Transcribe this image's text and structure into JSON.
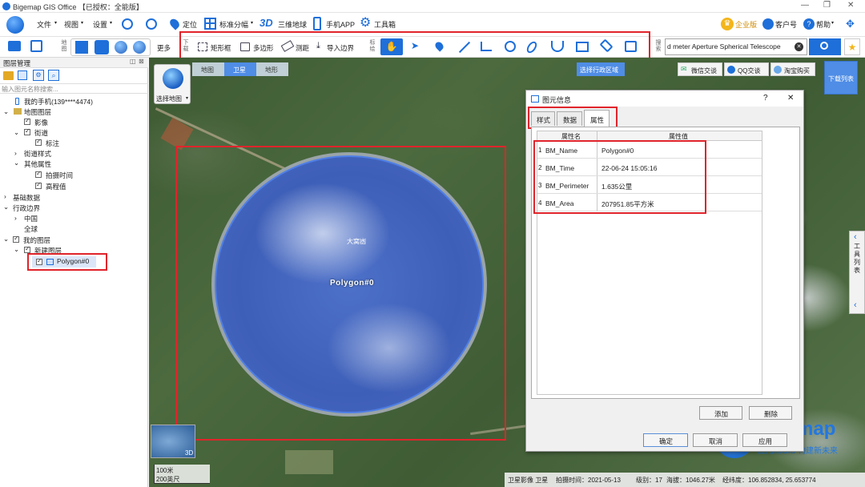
{
  "titlebar": {
    "title": "Bigemap GIS Office 【已授权：全能版】"
  },
  "menu": {
    "file": "文件",
    "view": "视图",
    "settings": "设置",
    "locate": "定位",
    "standard_tiles": "标准分幅",
    "three_d": "3D",
    "three_d_earth": "三维地球",
    "mobile_app": "手机APP",
    "toolbox": "工具箱",
    "enterprise": "企业版",
    "customer": "客户号",
    "help": "帮助"
  },
  "toolbar": {
    "map_label": "地图",
    "more": "更多",
    "download_label": "下载",
    "rect_frame": "矩形框",
    "polygon": "多边形",
    "measure": "测距",
    "import_boundary": "导入边界",
    "mark_label": "标绘",
    "search_label": "搜索",
    "search_value": "d meter Aperture Spherical Telescope"
  },
  "leftpanel": {
    "title": "图层管理",
    "search_placeholder": "输入图元名称搜索...",
    "tree": {
      "phone": "我的手机(139****4474)",
      "map_layers": "地图图层",
      "imagery": "影像",
      "street": "街道",
      "annotation": "标注",
      "street_style": "街道样式",
      "other_props": "其他属性",
      "capture_time": "拍摄时间",
      "elevation": "高程值",
      "base_data": "基础数据",
      "admin_boundary": "行政边界",
      "china": "中国",
      "global": "全球",
      "my_layers": "我的图层",
      "new_layer": "新建图层",
      "polygon_item": "Polygon#0"
    }
  },
  "map": {
    "tabs": [
      "地图",
      "卫星",
      "地形"
    ],
    "select_map": "选择地图",
    "select_region": "选择行政区域",
    "wechat": "微信交谈",
    "qq": "QQ交谈",
    "taobao": "淘宝购买",
    "download_list": "下载列表",
    "polygon_label": "Polygon#0",
    "place_label": "大窝凼",
    "tool_list": "工具列表",
    "scale_1": "100米",
    "scale_2": "200英尺",
    "minimap_3d": "3D",
    "status": {
      "imagery": "卫星影像 卫星",
      "capture_time": "拍摄时间：2021-05-13",
      "level": "级别：17",
      "altitude": "海拔：1046.27米",
      "coords": "经纬度：106.852834, 25.653774"
    },
    "watermark_brand": "Bigemap",
    "watermark_slogan": "应用新GIS 构建新未来"
  },
  "dialog": {
    "title": "图元信息",
    "help": "?",
    "close": "✕",
    "tabs": [
      "样式",
      "数据",
      "属性"
    ],
    "col_name": "属性名",
    "col_value": "属性值",
    "rows": [
      {
        "idx": "1",
        "name": "BM_Name",
        "value": "Polygon#0"
      },
      {
        "idx": "2",
        "name": "BM_Time",
        "value": "22-06-24 15:05:16"
      },
      {
        "idx": "3",
        "name": "BM_Perimeter",
        "value": "1.635公里"
      },
      {
        "idx": "4",
        "name": "BM_Area",
        "value": "207951.85平方米"
      }
    ],
    "add": "添加",
    "delete": "删除",
    "ok": "确定",
    "cancel": "取消",
    "apply": "应用"
  },
  "colors": {
    "highlight": "#e0242b",
    "accent": "#1e6fd9",
    "polygon_fill": "#3f6fd8"
  }
}
